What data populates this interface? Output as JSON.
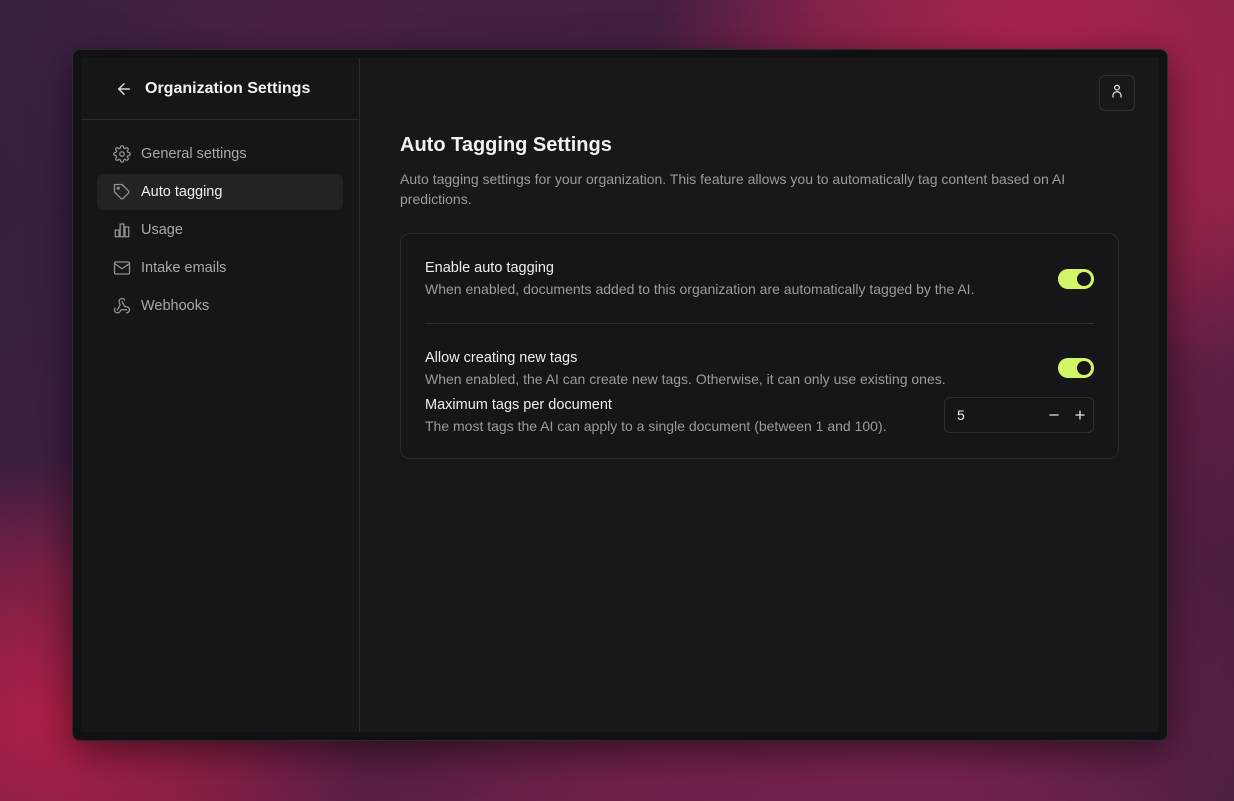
{
  "sidebar": {
    "title": "Organization Settings",
    "items": [
      {
        "label": "General settings",
        "icon": "gear-icon"
      },
      {
        "label": "Auto tagging",
        "icon": "tag-icon",
        "active": true
      },
      {
        "label": "Usage",
        "icon": "bar-chart-icon"
      },
      {
        "label": "Intake emails",
        "icon": "mail-icon"
      },
      {
        "label": "Webhooks",
        "icon": "webhook-icon"
      }
    ]
  },
  "header": {
    "user_icon": "user-icon"
  },
  "main": {
    "title": "Auto Tagging Settings",
    "description": "Auto tagging settings for your organization. This feature allows you to automatically tag content based on AI predictions.",
    "settings": {
      "enable": {
        "label": "Enable auto tagging",
        "description": "When enabled, documents added to this organization are automatically tagged by the AI.",
        "enabled": true
      },
      "allow_new": {
        "label": "Allow creating new tags",
        "description": "When enabled, the AI can create new tags. Otherwise, it can only use existing ones.",
        "enabled": true
      },
      "max_tags": {
        "label": "Maximum tags per document",
        "description": "The most tags the AI can apply to a single document (between 1 and 100).",
        "value": "5"
      }
    }
  },
  "colors": {
    "accent": "#d4f56a",
    "background": "#18181a",
    "sidebar": "#161618"
  }
}
